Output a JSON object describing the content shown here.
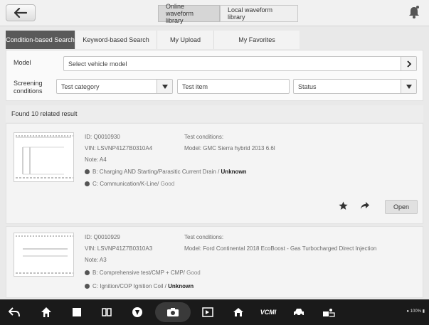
{
  "library_tabs": [
    "Online waveform library",
    "Local waveform library"
  ],
  "mode_tabs": [
    "Condition-based Search",
    "Keyword-based Search",
    "My Upload",
    "My Favorites"
  ],
  "form": {
    "model_label": "Model",
    "model_value": "Select vehicle model",
    "screening_label": "Screening conditions",
    "test_category": "Test category",
    "test_item": "Test item",
    "status": "Status"
  },
  "found_text": "Found 10 related result",
  "results": [
    {
      "id": "ID: Q0010930",
      "vin": "VIN: LSVNP41Z7B0310A4",
      "note": "Note: A4",
      "conditions_label": "Test conditions:",
      "model": "Model: GMC Sierra hybrid 2013 6.6l",
      "channel_b": "B: Charging AND Starting/Parasitic Current Drain /",
      "channel_b_status": "Unknown",
      "channel_c": "C: Communication/K-Line/",
      "channel_c_status": "Good",
      "open_label": "Open"
    },
    {
      "id": "ID: Q0010929",
      "vin": "VIN: LSVNP41Z7B0310A3",
      "note": "Note: A3",
      "conditions_label": "Test conditions:",
      "model": "Model: Ford Continental 2018 EcoBoost - Gas Turbocharged Direct Injection",
      "channel_b": "B: Comprehensive test/CMP + CMP/",
      "channel_b_status": "Good",
      "channel_c": "C: Ignition/COP Ignition Coil /",
      "channel_c_status": "Unknown"
    }
  ],
  "bottom_nav": {
    "vcmi_label": "VCMI"
  },
  "status_bar": {
    "text": "100%"
  }
}
